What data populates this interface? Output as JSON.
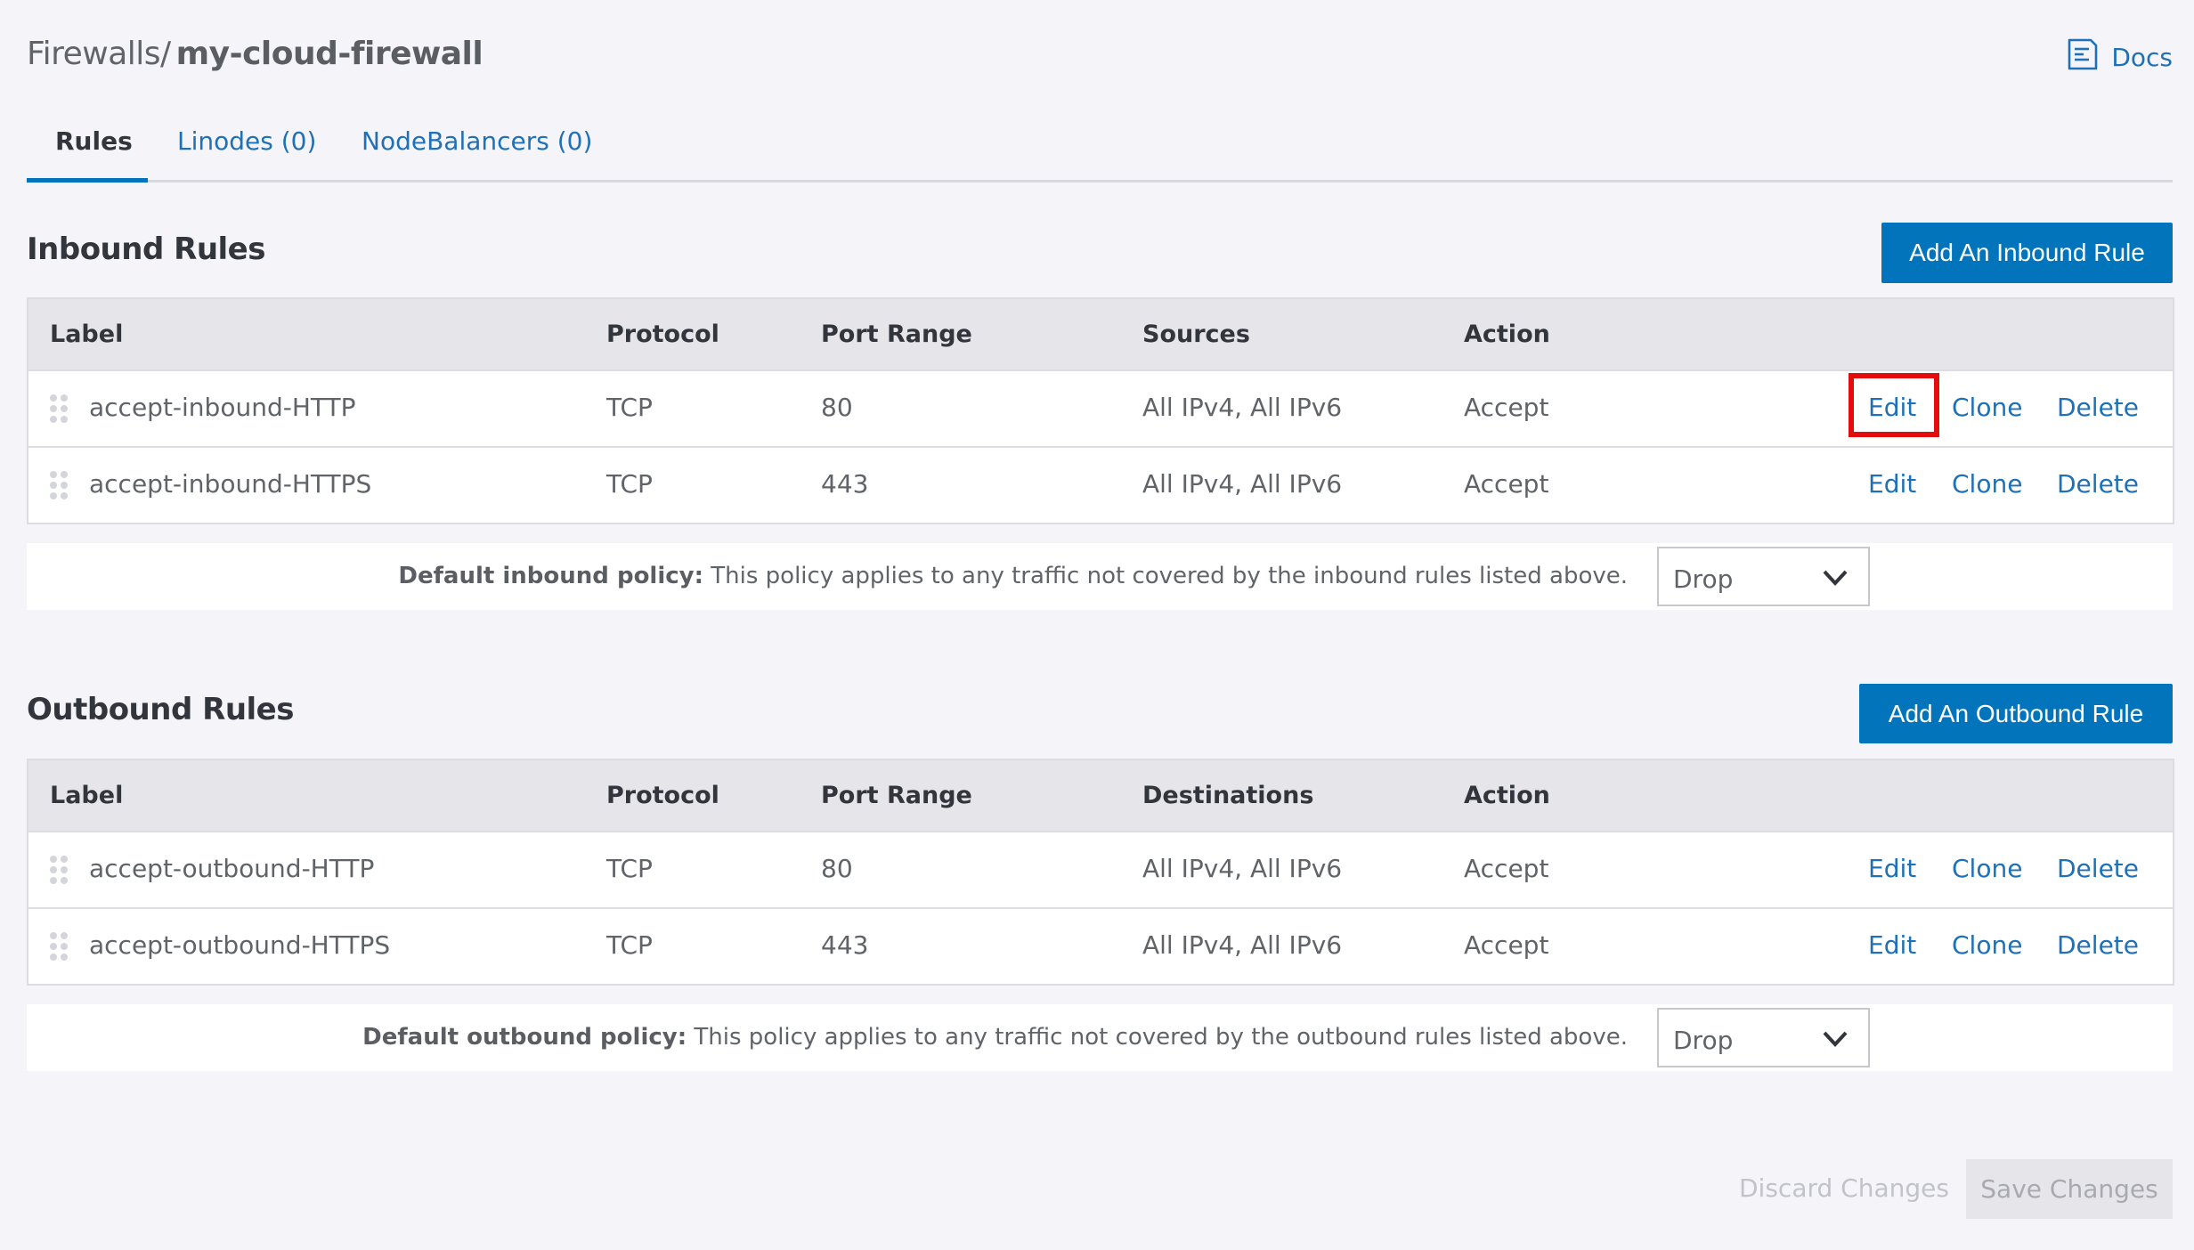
{
  "breadcrumb": {
    "parent": "Firewalls",
    "separator": "/",
    "current": "my-cloud-firewall"
  },
  "docs": {
    "label": "Docs",
    "icon": "docs-icon"
  },
  "tabs": [
    {
      "label": "Rules",
      "active": true
    },
    {
      "label": "Linodes (0)",
      "active": false
    },
    {
      "label": "NodeBalancers (0)",
      "active": false
    }
  ],
  "inbound": {
    "title": "Inbound Rules",
    "add_button": "Add An Inbound Rule",
    "columns": [
      "Label",
      "Protocol",
      "Port Range",
      "Sources",
      "Action"
    ],
    "rows": [
      {
        "label": "accept-inbound-HTTP",
        "protocol": "TCP",
        "ports": "80",
        "addresses": "All IPv4, All IPv6",
        "action": "Accept"
      },
      {
        "label": "accept-inbound-HTTPS",
        "protocol": "TCP",
        "ports": "443",
        "addresses": "All IPv4, All IPv6",
        "action": "Accept"
      }
    ],
    "policy_label": "Default inbound policy:",
    "policy_text": "This policy applies to any traffic not covered by the inbound rules listed above.",
    "policy_value": "Drop"
  },
  "outbound": {
    "title": "Outbound Rules",
    "add_button": "Add An Outbound Rule",
    "columns": [
      "Label",
      "Protocol",
      "Port Range",
      "Destinations",
      "Action"
    ],
    "rows": [
      {
        "label": "accept-outbound-HTTP",
        "protocol": "TCP",
        "ports": "80",
        "addresses": "All IPv4, All IPv6",
        "action": "Accept"
      },
      {
        "label": "accept-outbound-HTTPS",
        "protocol": "TCP",
        "ports": "443",
        "addresses": "All IPv4, All IPv6",
        "action": "Accept"
      }
    ],
    "policy_label": "Default outbound policy:",
    "policy_text": "This policy applies to any traffic not covered by the outbound rules listed above.",
    "policy_value": "Drop"
  },
  "row_actions": {
    "edit": "Edit",
    "clone": "Clone",
    "delete": "Delete"
  },
  "footer": {
    "discard": "Discard Changes",
    "save": "Save Changes"
  },
  "colors": {
    "accent": "#0174bc",
    "link": "#1f71b7",
    "highlight": "#e30d0d"
  }
}
